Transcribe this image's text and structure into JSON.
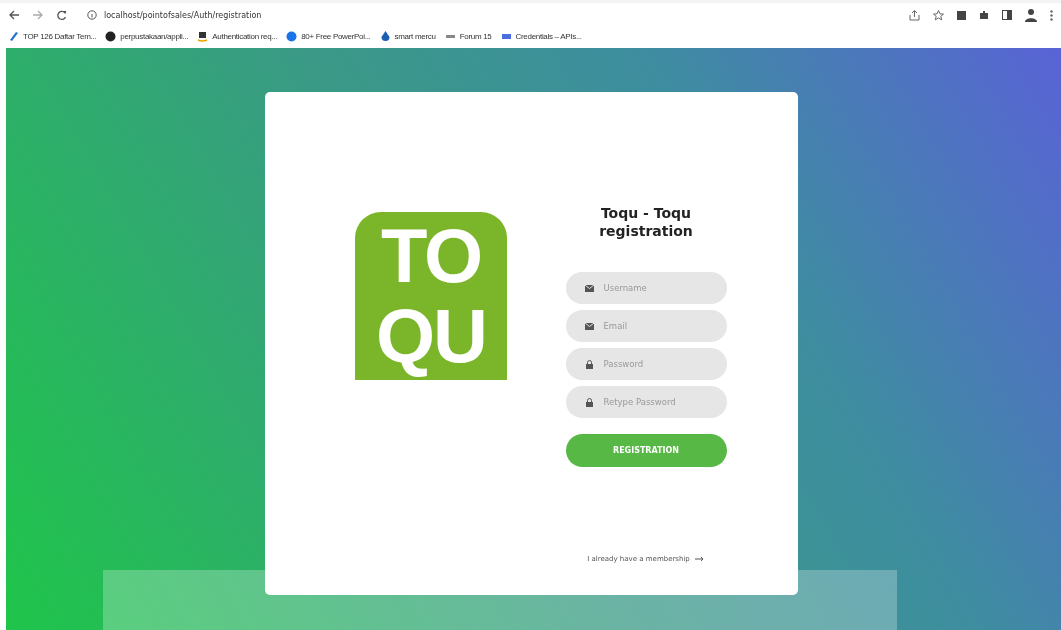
{
  "browser": {
    "address": "localhost/pointofsales/Auth/registration",
    "bookmarks": [
      {
        "label": "TOP 126 Daftar Tem...",
        "kind": "pen"
      },
      {
        "label": "perpustakaan/appli...",
        "kind": "github"
      },
      {
        "label": "Authentication req...",
        "kind": "amazon"
      },
      {
        "label": "80+ Free PowerPoi...",
        "kind": "blue"
      },
      {
        "label": "smart mercu",
        "kind": "drop"
      },
      {
        "label": "Forum 15",
        "kind": "km"
      },
      {
        "label": "Credentials – APIs...",
        "kind": "api"
      }
    ]
  },
  "logo": {
    "top": "TO",
    "bottom": "QU"
  },
  "form": {
    "title": "Toqu - Toqu registration",
    "fields": [
      {
        "placeholder": "Username",
        "kind": "mail"
      },
      {
        "placeholder": "Email",
        "kind": "mail"
      },
      {
        "placeholder": "Password",
        "kind": "lock"
      },
      {
        "placeholder": "Retype Password",
        "kind": "lock"
      }
    ],
    "button": "REGISTRATION",
    "link": "I already have a membership"
  }
}
